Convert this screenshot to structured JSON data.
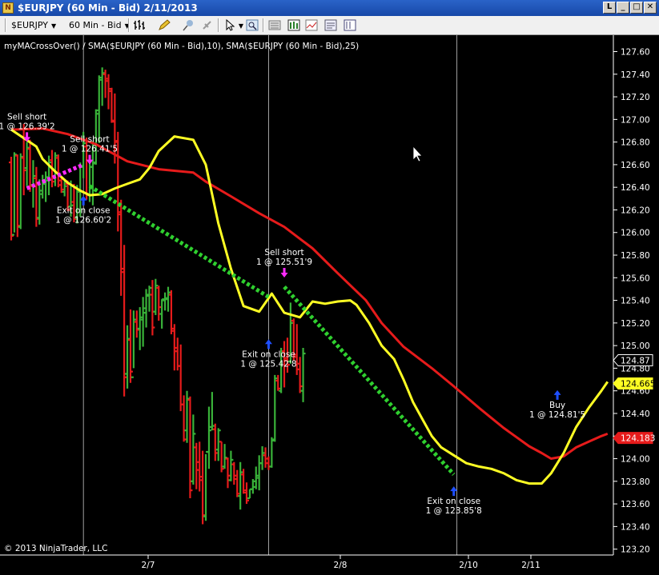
{
  "window": {
    "title": "$EURJPY (60 Min - Bid)  2/11/2013",
    "icon_name": "ninjatrader-chart-icon",
    "buttons": [
      "restore-button",
      "minimize-button",
      "maximize-button",
      "close-button"
    ]
  },
  "toolbar": {
    "instrument": "$EURJPY",
    "period": "60 Min - Bid",
    "icons": [
      "bar-type-icon",
      "drawing-pencil-icon",
      "pin-icon",
      "pointer-icon",
      "pointer-menu-icon",
      "zoom-icon",
      "strategy-icon",
      "properties-icon",
      "chart-trader-icon",
      "data-box-icon",
      "indicators-icon"
    ]
  },
  "chart_data": {
    "type": "bar",
    "description_line": "myMACrossOver() / SMA($EURJPY (60 Min - Bid),10), SMA($EURJPY (60 Min - Bid),25)",
    "copyright": "© 2013 NinjaTrader, LLC",
    "ylim": [
      123.2,
      127.7
    ],
    "y_ticks": [
      "127.60",
      "127.40",
      "127.20",
      "127.00",
      "126.80",
      "126.60",
      "126.40",
      "126.20",
      "126.00",
      "125.80",
      "125.60",
      "125.40",
      "125.20",
      "125.00",
      "124.80",
      "124.60",
      "124.40",
      "124.20",
      "124.00",
      "123.80",
      "123.60",
      "123.40",
      "123.20"
    ],
    "x_ticks": [
      "2/7",
      "2/8",
      "2/10",
      "2/11"
    ],
    "colors": {
      "up_bar": "#39b239",
      "down_bar": "#e61b1b",
      "sma10": "#ffff24",
      "sma25": "#e61b1b",
      "trade_line": "#2fcf2f",
      "sell_arrow": "#ff2bff",
      "buy_arrow": "#1e4fff"
    },
    "price_badges": [
      {
        "label": "124.87",
        "value": 124.87,
        "background": "#000000",
        "text_color": "#ffffff",
        "border": "#ffffff"
      },
      {
        "label": "124.665",
        "value": 124.665,
        "background": "#ffff24",
        "text_color": "#000000",
        "border": "#ffff24"
      },
      {
        "label": "124.183",
        "value": 124.183,
        "background": "#e61b1b",
        "text_color": "#ffffff",
        "border": "#e61b1b"
      }
    ],
    "bars": [
      [
        126.62,
        126.67,
        125.93,
        125.97
      ],
      [
        125.98,
        126.71,
        126.0,
        126.69
      ],
      [
        126.68,
        126.69,
        125.96,
        126.06
      ],
      [
        126.05,
        126.7,
        126.03,
        126.67
      ],
      [
        126.66,
        126.96,
        126.33,
        126.55
      ],
      [
        126.57,
        126.8,
        126.41,
        126.75
      ],
      [
        126.74,
        126.82,
        126.36,
        126.41
      ],
      [
        126.42,
        126.64,
        126.22,
        126.5
      ],
      [
        126.48,
        126.58,
        126.05,
        126.12
      ],
      [
        126.13,
        126.47,
        126.07,
        126.37
      ],
      [
        126.34,
        126.51,
        126.3,
        126.43
      ],
      [
        126.44,
        126.54,
        126.27,
        126.49
      ],
      [
        126.46,
        126.68,
        126.33,
        126.62
      ],
      [
        126.64,
        126.73,
        126.4,
        126.45
      ],
      [
        126.5,
        126.71,
        126.41,
        126.68
      ],
      [
        126.66,
        126.69,
        126.4,
        126.42
      ],
      [
        126.46,
        126.5,
        126.35,
        126.38
      ],
      [
        126.36,
        126.46,
        126.32,
        126.41
      ],
      [
        126.43,
        126.46,
        126.19,
        126.2
      ],
      [
        126.23,
        126.46,
        126.14,
        126.24
      ],
      [
        126.27,
        126.43,
        126.09,
        126.12
      ],
      [
        126.13,
        126.42,
        126.08,
        126.38
      ],
      [
        126.36,
        126.62,
        126.14,
        126.59
      ],
      [
        126.58,
        126.89,
        126.48,
        126.79
      ],
      [
        126.76,
        126.84,
        126.29,
        126.34
      ],
      [
        126.33,
        126.62,
        126.27,
        126.58
      ],
      [
        126.58,
        126.81,
        126.24,
        126.62
      ],
      [
        126.61,
        127.09,
        126.6,
        127.08
      ],
      [
        127.05,
        127.39,
        126.79,
        127.37
      ],
      [
        127.35,
        127.46,
        127.12,
        127.41
      ],
      [
        127.4,
        127.44,
        127.19,
        127.34
      ],
      [
        127.36,
        127.4,
        127.09,
        127.27
      ],
      [
        127.25,
        127.28,
        126.97,
        126.99
      ],
      [
        126.98,
        127.23,
        126.61,
        126.8
      ],
      [
        126.81,
        126.89,
        126.01,
        126.16
      ],
      [
        126.18,
        126.29,
        125.44,
        125.68
      ],
      [
        125.65,
        125.89,
        124.55,
        124.72
      ],
      [
        124.75,
        125.18,
        124.62,
        125.06
      ],
      [
        125.05,
        125.32,
        124.67,
        124.77
      ],
      [
        124.72,
        125.31,
        124.8,
        125.23
      ],
      [
        125.21,
        125.31,
        125.07,
        125.14
      ],
      [
        125.15,
        125.34,
        124.96,
        125.25
      ],
      [
        125.23,
        125.43,
        124.99,
        125.29
      ],
      [
        125.33,
        125.5,
        125.16,
        125.44
      ],
      [
        125.45,
        125.53,
        125.3,
        125.51
      ],
      [
        125.45,
        125.58,
        125.09,
        125.16
      ],
      [
        125.3,
        125.59,
        125.27,
        125.53
      ],
      [
        125.51,
        125.53,
        125.22,
        125.34
      ],
      [
        125.28,
        125.41,
        125.15,
        125.41
      ],
      [
        125.4,
        125.47,
        125.31,
        125.41
      ],
      [
        125.42,
        125.52,
        125.3,
        125.47
      ],
      [
        125.45,
        125.49,
        125.1,
        125.15
      ],
      [
        125.13,
        125.19,
        124.78,
        124.98
      ],
      [
        124.95,
        125.07,
        124.78,
        124.82
      ],
      [
        124.82,
        125.01,
        124.42,
        124.48
      ],
      [
        124.48,
        124.56,
        124.15,
        124.17
      ],
      [
        124.25,
        124.6,
        124.14,
        124.53
      ],
      [
        124.52,
        124.55,
        123.65,
        123.72
      ],
      [
        123.8,
        124.39,
        123.77,
        124.22
      ],
      [
        124.1,
        124.14,
        123.73,
        123.9
      ],
      [
        123.97,
        124.15,
        123.71,
        123.84
      ],
      [
        123.81,
        124.07,
        123.42,
        123.5
      ],
      [
        123.49,
        124.04,
        123.45,
        124.06
      ],
      [
        124.06,
        124.46,
        123.91,
        124.25
      ],
      [
        124.28,
        124.59,
        124.25,
        124.29
      ],
      [
        124.26,
        124.31,
        123.98,
        124.05
      ],
      [
        124.08,
        124.27,
        123.98,
        124.25
      ],
      [
        124.15,
        124.15,
        123.88,
        123.91
      ],
      [
        123.93,
        124.13,
        123.91,
        124.01
      ],
      [
        124.0,
        124.01,
        123.74,
        123.85
      ],
      [
        123.81,
        124.07,
        123.8,
        123.99
      ],
      [
        123.95,
        123.97,
        123.77,
        123.85
      ],
      [
        123.82,
        123.9,
        123.66,
        123.69
      ],
      [
        123.67,
        123.97,
        123.55,
        123.88
      ],
      [
        123.86,
        123.91,
        123.69,
        123.72
      ],
      [
        123.7,
        123.79,
        123.6,
        123.63
      ],
      [
        123.65,
        123.73,
        123.65,
        123.73
      ],
      [
        123.73,
        123.82,
        123.69,
        123.75
      ],
      [
        123.8,
        123.93,
        123.73,
        123.85
      ],
      [
        123.83,
        124.03,
        123.72,
        123.96
      ],
      [
        123.96,
        124.11,
        123.9,
        124.05
      ],
      [
        124.03,
        124.1,
        123.92,
        123.96
      ],
      [
        124.0,
        124.02,
        123.9,
        123.93
      ],
      [
        123.93,
        124.19,
        123.92,
        124.16
      ],
      [
        124.17,
        124.74,
        124.15,
        124.71
      ],
      [
        124.69,
        124.74,
        124.6,
        124.62
      ],
      [
        124.6,
        124.98,
        124.58,
        124.95
      ],
      [
        124.95,
        125.04,
        124.63,
        124.89
      ],
      [
        124.87,
        125.07,
        124.76,
        124.83
      ],
      [
        124.86,
        125.38,
        124.84,
        125.2
      ],
      [
        125.22,
        125.24,
        124.87,
        124.92
      ],
      [
        124.9,
        125.19,
        124.74,
        124.79
      ],
      [
        124.84,
        124.9,
        124.58,
        124.64
      ],
      [
        124.6,
        124.98,
        124.5,
        124.93
      ]
    ],
    "sma10": [
      [
        0,
        126.91
      ],
      [
        8,
        126.76
      ],
      [
        10,
        126.65
      ],
      [
        14,
        126.54
      ],
      [
        18,
        126.44
      ],
      [
        22,
        126.37
      ],
      [
        25,
        126.33
      ],
      [
        29,
        126.34
      ],
      [
        33,
        126.39
      ],
      [
        37,
        126.43
      ],
      [
        41,
        126.47
      ],
      [
        44,
        126.57
      ],
      [
        47,
        126.72
      ],
      [
        52,
        126.85
      ],
      [
        58,
        126.82
      ],
      [
        62,
        126.6
      ],
      [
        66,
        126.08
      ],
      [
        70,
        125.68
      ],
      [
        74,
        125.35
      ],
      [
        79,
        125.3
      ],
      [
        83,
        125.46
      ],
      [
        87,
        125.29
      ],
      [
        92,
        125.25
      ],
      [
        96,
        125.39
      ],
      [
        100,
        125.37
      ],
      [
        104,
        125.39
      ],
      [
        108,
        125.4
      ],
      [
        110,
        125.36
      ],
      [
        114,
        125.2
      ],
      [
        118,
        125.0
      ],
      [
        122,
        124.88
      ],
      [
        125,
        124.7
      ],
      [
        128,
        124.5
      ],
      [
        131,
        124.35
      ],
      [
        134,
        124.2
      ],
      [
        137,
        124.1
      ],
      [
        141,
        124.03
      ],
      [
        145,
        123.96
      ],
      [
        149,
        123.93
      ],
      [
        153,
        123.91
      ],
      [
        157,
        123.87
      ],
      [
        161,
        123.81
      ],
      [
        165,
        123.78
      ],
      [
        169,
        123.78
      ],
      [
        172,
        123.87
      ],
      [
        176,
        124.05
      ],
      [
        180,
        124.28
      ],
      [
        184,
        124.45
      ],
      [
        188,
        124.6
      ],
      [
        190,
        124.68
      ]
    ],
    "sma25": [
      [
        0,
        126.91
      ],
      [
        10,
        126.92
      ],
      [
        18,
        126.87
      ],
      [
        27,
        126.78
      ],
      [
        37,
        126.63
      ],
      [
        47,
        126.56
      ],
      [
        58,
        126.53
      ],
      [
        62,
        126.45
      ],
      [
        70,
        126.32
      ],
      [
        79,
        126.17
      ],
      [
        87,
        126.05
      ],
      [
        96,
        125.86
      ],
      [
        104,
        125.64
      ],
      [
        113,
        125.4
      ],
      [
        118,
        125.2
      ],
      [
        125,
        124.99
      ],
      [
        134,
        124.8
      ],
      [
        141,
        124.64
      ],
      [
        149,
        124.45
      ],
      [
        157,
        124.27
      ],
      [
        165,
        124.11
      ],
      [
        169,
        124.05
      ],
      [
        172,
        124.0
      ],
      [
        176,
        124.02
      ],
      [
        180,
        124.1
      ],
      [
        184,
        124.15
      ],
      [
        188,
        124.2
      ],
      [
        190,
        124.22
      ]
    ],
    "trade_lines": [
      {
        "from": [
          5,
          126.39
        ],
        "to": [
          23,
          126.6
        ],
        "style": "dashed",
        "color": "#ff2bff"
      },
      {
        "from": [
          25,
          126.41
        ],
        "to": [
          82,
          125.43
        ],
        "style": "dashed",
        "color": "#2fcf2f"
      },
      {
        "from": [
          87,
          125.52
        ],
        "to": [
          141,
          123.86
        ],
        "style": "dashed",
        "color": "#2fcf2f"
      }
    ],
    "annotations": [
      {
        "text1": "Sell short",
        "text2": "1 @ 126.39'2",
        "x": 5,
        "y": 127.0,
        "arrow": "down",
        "color": "#ff2bff"
      },
      {
        "text1": "Sell short",
        "text2": "1 @ 126.41'5",
        "x": 25,
        "y": 126.8,
        "arrow": "down",
        "color": "#ff2bff"
      },
      {
        "text1": "Exit on close",
        "text2": "1 @ 126.60'2",
        "x": 23,
        "y": 126.17,
        "arrow": "up",
        "color": "#1e4fff"
      },
      {
        "text1": "Sell short",
        "text2": "1 @ 125.51'9",
        "x": 87,
        "y": 125.8,
        "arrow": "down",
        "color": "#ff2bff"
      },
      {
        "text1": "Exit on close",
        "text2": "1 @ 125.42'8",
        "x": 82,
        "y": 124.9,
        "arrow": "up",
        "color": "#1e4fff"
      },
      {
        "text1": "Exit on close",
        "text2": "1 @ 123.85'8",
        "x": 141,
        "y": 123.6,
        "arrow": "up",
        "color": "#1e4fff"
      },
      {
        "text1": "Buy",
        "text2": "1 @ 124.81'5",
        "x": 174,
        "y": 124.45,
        "arrow": "up",
        "color": "#1e4fff"
      }
    ],
    "session_lines": [
      23,
      82,
      142
    ],
    "grid": false,
    "legend": "none"
  }
}
